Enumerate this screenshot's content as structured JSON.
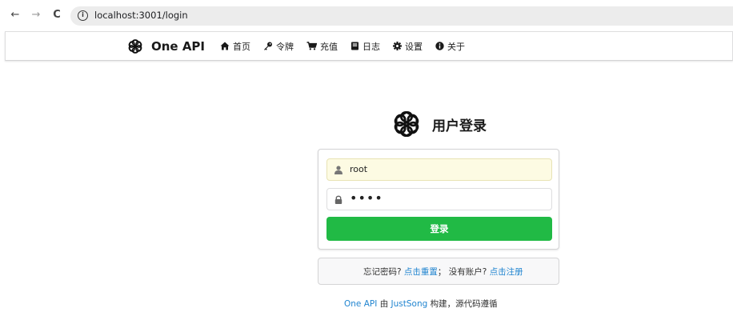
{
  "browser": {
    "back_icon": "←",
    "forward_icon": "→",
    "reload_icon": "C",
    "info_icon": "i",
    "url": "localhost:3001/login"
  },
  "header": {
    "brand": "One API",
    "menu": [
      {
        "label": "首页",
        "icon": "home-icon"
      },
      {
        "label": "令牌",
        "icon": "key-icon"
      },
      {
        "label": "充值",
        "icon": "cart-icon"
      },
      {
        "label": "日志",
        "icon": "book-icon"
      },
      {
        "label": "设置",
        "icon": "cog-icon"
      },
      {
        "label": "关于",
        "icon": "info-circle-icon"
      }
    ]
  },
  "login": {
    "title": "用户登录",
    "username_value": "root",
    "password_mask": "••••",
    "submit_label": "登录"
  },
  "message": {
    "forgot_text": "忘记密码?",
    "reset_link": "点击重置",
    "separator": "；",
    "no_account_text": "没有账户?",
    "register_link": "点击注册"
  },
  "footer": {
    "project_link": "One API",
    "by_text": "由",
    "author_link": "JustSong",
    "rest_text": "构建，源代码遵循"
  },
  "colors": {
    "primary_button": "#21ba45",
    "link": "#2185d0",
    "autofill_bg": "#fdfbe3"
  }
}
